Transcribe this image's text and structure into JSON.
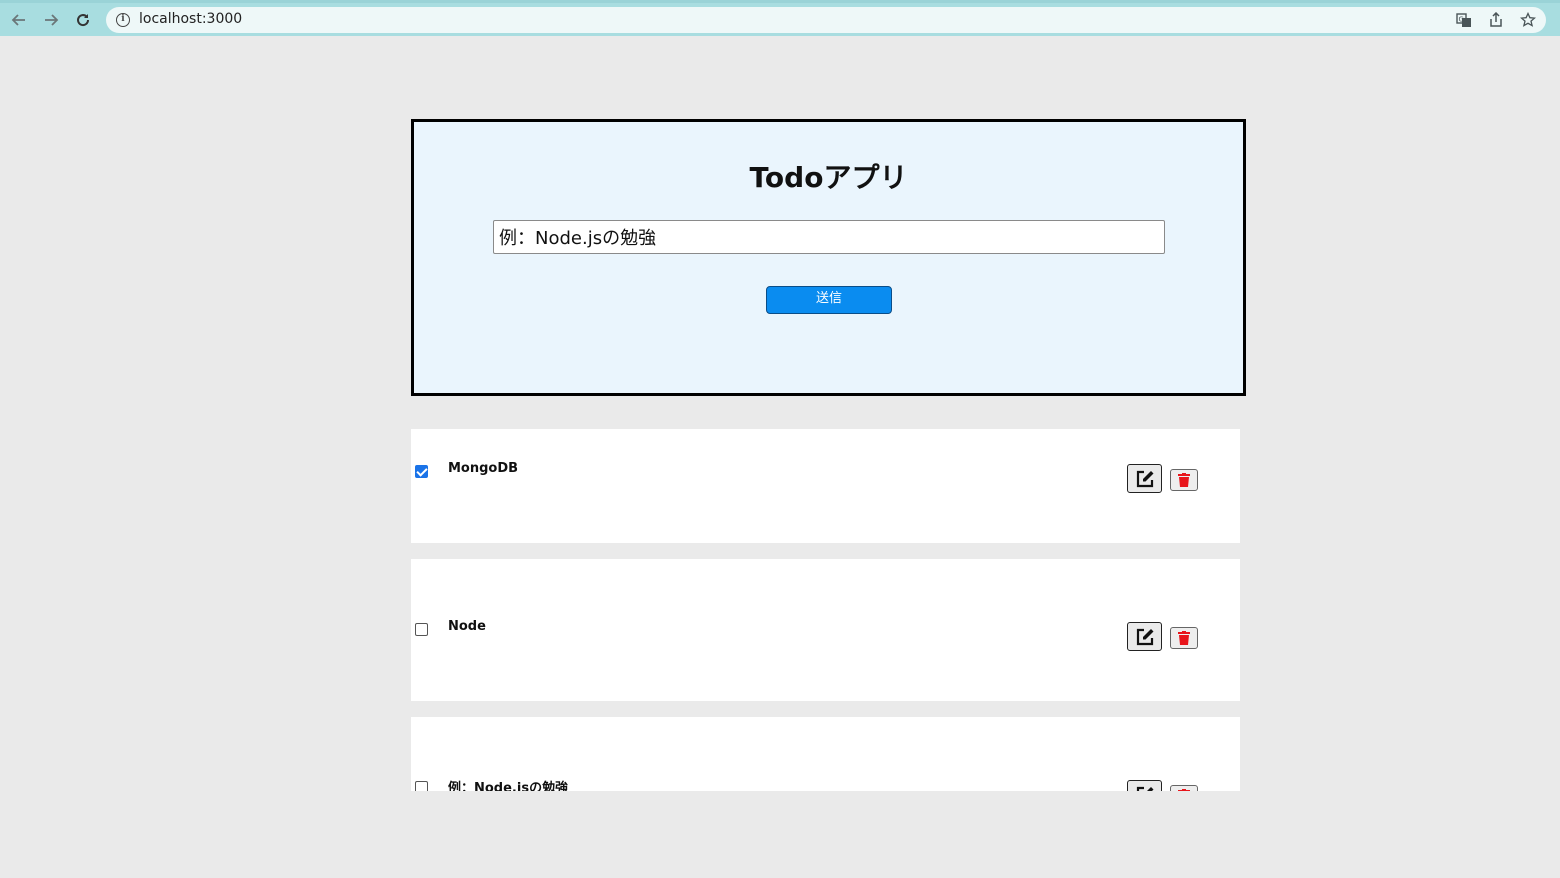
{
  "browser": {
    "url": "localhost:3000",
    "back_icon": "arrow-left-icon",
    "forward_icon": "arrow-right-icon",
    "reload_icon": "reload-icon"
  },
  "form": {
    "title": "Todoアプリ",
    "input_value": "例：Node.jsの勉強",
    "submit_label": "送信"
  },
  "todos": [
    {
      "text": "MongoDB",
      "checked": true
    },
    {
      "text": "Node",
      "checked": false
    },
    {
      "text": "例：Node.jsの勉強",
      "checked": false
    }
  ],
  "colors": {
    "accent": "#0a8cf0",
    "delete": "#e8151b",
    "card_bg": "#eaf5fd"
  }
}
